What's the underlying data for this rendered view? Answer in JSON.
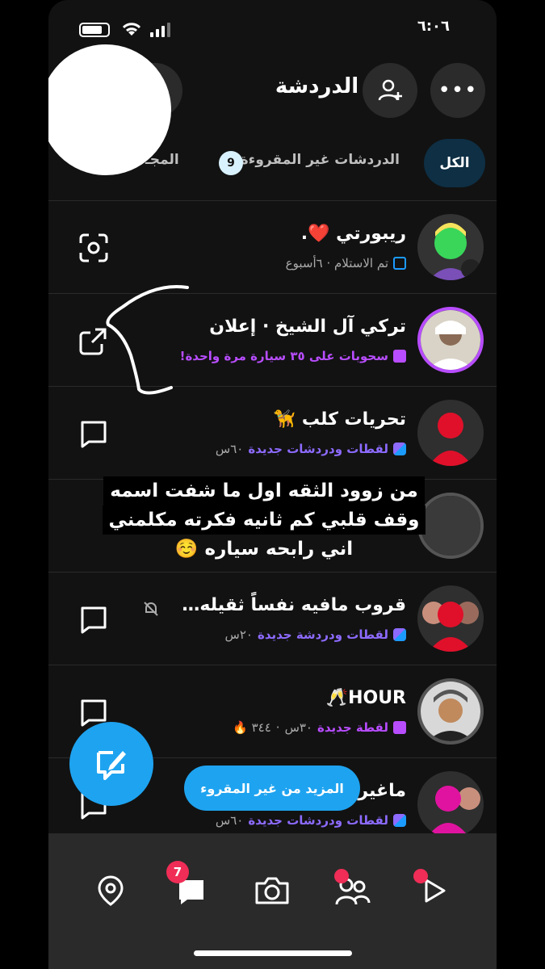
{
  "status_bar": {
    "time": "٦:٠٦"
  },
  "header": {
    "title": "الدردشة"
  },
  "tabs": {
    "all": "الكل",
    "unread": "الدردشات غير المقروءة",
    "unread_count": "9",
    "groups": "المجـ"
  },
  "chats": [
    {
      "name": "ريبورتي ❤️.",
      "status": "تم الاستلام · ٦أسبوع",
      "action_icon": "camera-scan-icon"
    },
    {
      "name": "تركي آل الشيخ · إعلان",
      "status": "سحوبات على ٣٥ سيارة مرة واحدة!",
      "action_icon": "share-icon"
    },
    {
      "name": "تحريات كلب 🦮",
      "status": "لقطات ودردشات جديدة",
      "time": "٦٠س",
      "action_icon": "chat-icon"
    },
    {
      "name": "قروب مافيه نفساً ثقيله…",
      "status": "لقطات ودردشة جديدة",
      "time": "٢٠س",
      "action_icon": "chat-icon"
    },
    {
      "name": "HOUR🥂",
      "status": "لقطة جديدة",
      "time": "٣٠س",
      "streak": "٣٤٤ 🔥",
      "action_icon": "chat-icon"
    },
    {
      "name": "ماغير",
      "status": "لقطات ودردشات جديدة",
      "time": "٦٠س",
      "action_icon": "chat-icon"
    }
  ],
  "caption": {
    "line1": "من زوود الثقه اول ما شفت اسمه",
    "line2": "وقف قلبي كم ثانيه فكرته مكلمني",
    "line3": "اني رابحه سياره ☺️"
  },
  "buttons": {
    "more_unread": "المزيد من غير المقروء"
  },
  "bottom_nav": {
    "chat_badge": "7"
  },
  "colors": {
    "accent_blue": "#1ea3f0",
    "purple": "#b84dff",
    "badge_red": "#ef2d56"
  }
}
